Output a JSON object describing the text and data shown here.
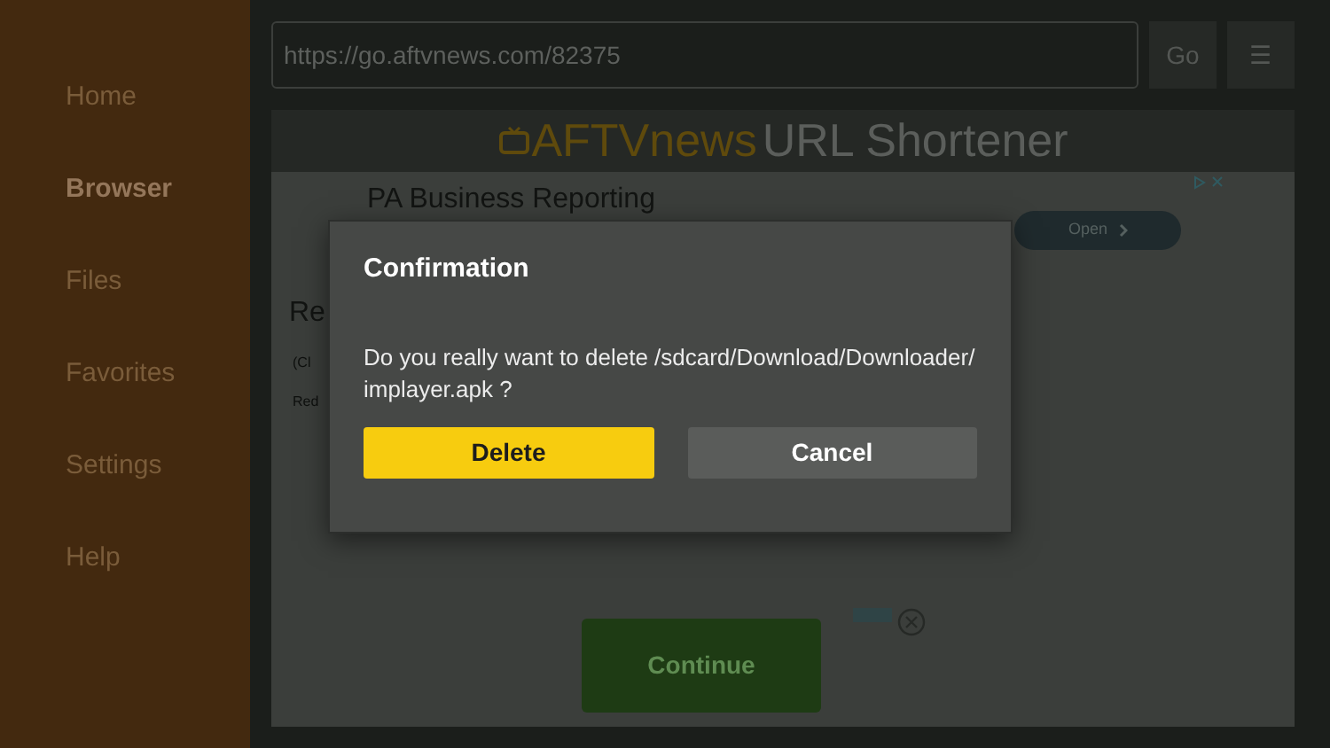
{
  "sidebar": {
    "items": [
      {
        "label": "Home",
        "selected": false
      },
      {
        "label": "Browser",
        "selected": true
      },
      {
        "label": "Files",
        "selected": false
      },
      {
        "label": "Favorites",
        "selected": false
      },
      {
        "label": "Settings",
        "selected": false
      },
      {
        "label": "Help",
        "selected": false
      }
    ]
  },
  "toolbar": {
    "url": "https://go.aftvnews.com/82375",
    "go_button": "Go",
    "menu_button": "☰"
  },
  "web_page": {
    "header": {
      "logo": "AFTVnews",
      "title": "URL Shortener"
    },
    "ad": {
      "headline": "PA Business Reporting",
      "button": "Open"
    },
    "heading": "Re",
    "lines": [
      "(Cl",
      "Red"
    ],
    "continue_button": "Continue"
  },
  "dialog": {
    "title": "Confirmation",
    "message": "Do you really want to delete /sdcard/Download/Downloader/ implayer.apk ?",
    "buttons": [
      {
        "label": "Delete",
        "kind": "primary"
      },
      {
        "label": "Cancel",
        "kind": "secondary"
      }
    ]
  }
}
